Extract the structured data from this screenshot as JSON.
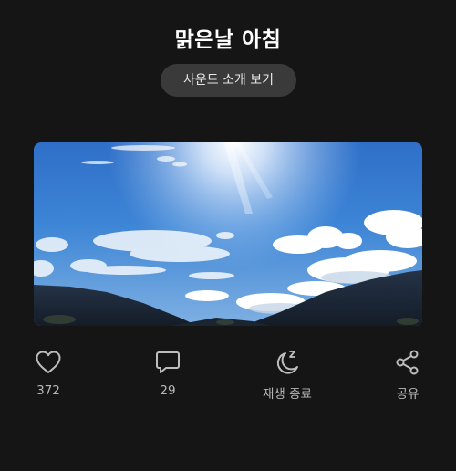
{
  "header": {
    "title": "맑은날 아침",
    "intro_button_label": "사운드 소개 보기"
  },
  "artwork": {
    "description_icon": "sky-mountain-image"
  },
  "actions": {
    "like": {
      "icon": "heart-icon",
      "label": "372"
    },
    "comment": {
      "icon": "comment-icon",
      "label": "29"
    },
    "sleep_timer": {
      "icon": "moon-zz-icon",
      "label": "재생 종료"
    },
    "share": {
      "icon": "share-icon",
      "label": "공유"
    }
  },
  "colors": {
    "background": "#151515",
    "button_bg": "#3a3a3a",
    "label_text": "#b7b7b7",
    "icon_stroke": "#bdbdbd"
  }
}
